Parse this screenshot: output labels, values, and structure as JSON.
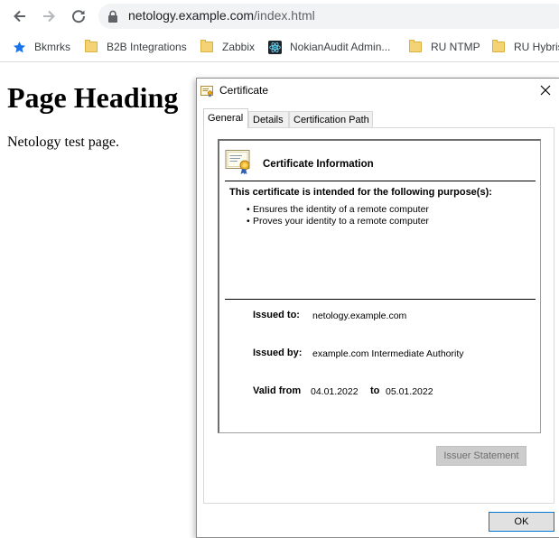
{
  "browser": {
    "url_host": "netology.example.com",
    "url_path": "/index.html",
    "bookmarks": [
      {
        "label": "Bkmrks",
        "icon": "star-icon"
      },
      {
        "label": "B2B Integrations",
        "icon": "folder-icon"
      },
      {
        "label": "Zabbix",
        "icon": "folder-icon"
      },
      {
        "label": "NokianAudit Admin...",
        "icon": "react-icon"
      },
      {
        "label": "RU NTMP",
        "icon": "folder-icon"
      },
      {
        "label": "RU Hybris",
        "icon": "folder-icon"
      }
    ]
  },
  "page": {
    "heading": "Page Heading",
    "text": "Netology test page."
  },
  "dialog": {
    "title": "Certificate",
    "tabs": [
      "General",
      "Details",
      "Certification Path"
    ],
    "active_tab": "General",
    "info_title": "Certificate Information",
    "purpose_heading": "This certificate is intended for the following purpose(s):",
    "purposes": [
      "Ensures the identity of a remote computer",
      "Proves your identity to a remote computer"
    ],
    "issued_to_label": "Issued to:",
    "issued_to": "netology.example.com",
    "issued_by_label": "Issued by:",
    "issued_by": "example.com Intermediate Authority",
    "valid_from_label": "Valid from",
    "valid_from": "04.01.2022",
    "valid_to_label": "to",
    "valid_to": "05.01.2022",
    "issuer_statement_label": "Issuer Statement",
    "ok_label": "OK"
  },
  "colors": {
    "accent": "#0078d7",
    "star": "#1a73e8",
    "folder": "#f3d375"
  }
}
